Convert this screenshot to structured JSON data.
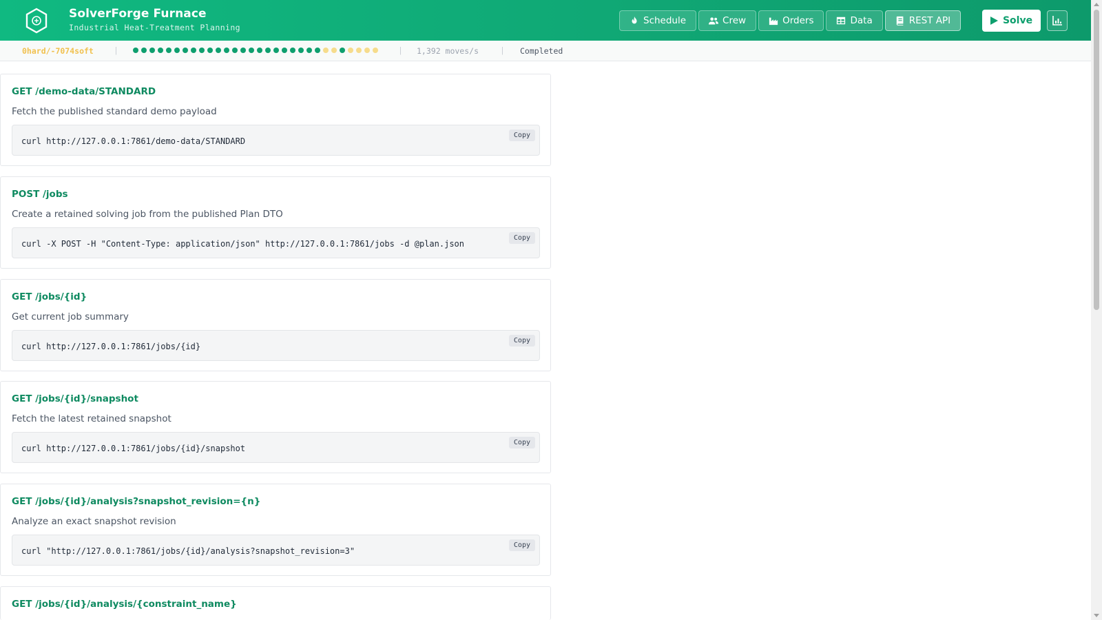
{
  "app": {
    "title": "SolverForge Furnace",
    "subtitle": "Industrial Heat-Treatment Planning"
  },
  "nav": {
    "items": [
      {
        "label": "Schedule",
        "icon": "flame-icon",
        "active": false
      },
      {
        "label": "Crew",
        "icon": "users-icon",
        "active": false
      },
      {
        "label": "Orders",
        "icon": "industry-icon",
        "active": false
      },
      {
        "label": "Data",
        "icon": "table-icon",
        "active": false
      },
      {
        "label": "REST API",
        "icon": "book-icon",
        "active": true
      }
    ],
    "solve_label": "Solve",
    "chart_button_icon": "chart-icon"
  },
  "status": {
    "score": "0hard/-7074soft",
    "moves": "1,392 moves/s",
    "state": "Completed",
    "progress_dots": [
      "g",
      "g",
      "g",
      "g",
      "g",
      "g",
      "g",
      "g",
      "g",
      "g",
      "g",
      "g",
      "g",
      "g",
      "g",
      "g",
      "g",
      "g",
      "g",
      "g",
      "g",
      "g",
      "g",
      "y",
      "y",
      "g",
      "y",
      "y",
      "y",
      "y"
    ]
  },
  "colors": {
    "brand": "#10b981",
    "accent_text": "#0e8a60",
    "score": "#f1c14f",
    "dot_green": "#0e9f6e",
    "dot_yellow": "#f6dc8c"
  },
  "endpoints": [
    {
      "title": "GET /demo-data/STANDARD",
      "desc": "Fetch the published standard demo payload",
      "code": "curl http://127.0.0.1:7861/demo-data/STANDARD",
      "copy": "Copy"
    },
    {
      "title": "POST /jobs",
      "desc": "Create a retained solving job from the published Plan DTO",
      "code": "curl -X POST -H \"Content-Type: application/json\" http://127.0.0.1:7861/jobs -d @plan.json",
      "copy": "Copy"
    },
    {
      "title": "GET /jobs/{id}",
      "desc": "Get current job summary",
      "code": "curl http://127.0.0.1:7861/jobs/{id}",
      "copy": "Copy"
    },
    {
      "title": "GET /jobs/{id}/snapshot",
      "desc": "Fetch the latest retained snapshot",
      "code": "curl http://127.0.0.1:7861/jobs/{id}/snapshot",
      "copy": "Copy"
    },
    {
      "title": "GET /jobs/{id}/analysis?snapshot_revision={n}",
      "desc": "Analyze an exact snapshot revision",
      "code": "curl \"http://127.0.0.1:7861/jobs/{id}/analysis?snapshot_revision=3\"",
      "copy": "Copy"
    },
    {
      "title": "GET /jobs/{id}/analysis/{constraint_name}",
      "desc": "",
      "code": "",
      "copy": ""
    }
  ]
}
